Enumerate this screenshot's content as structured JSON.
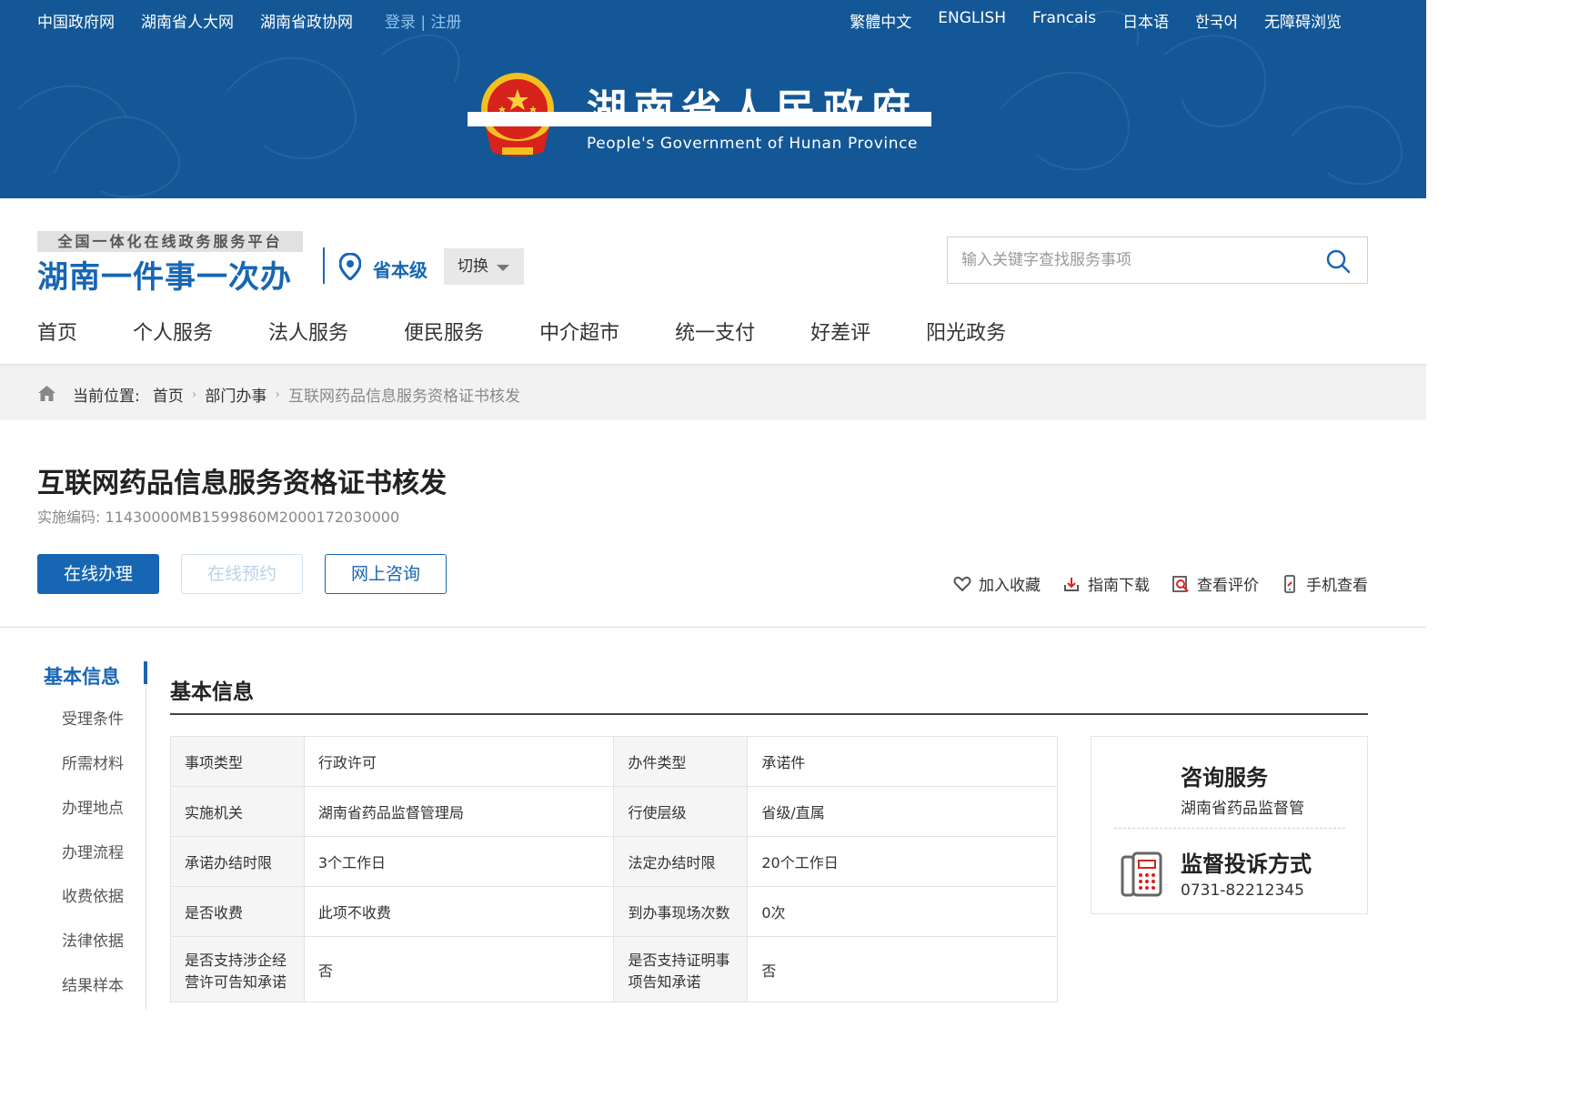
{
  "top_links": [
    "中国政府网",
    "湖南省人大网",
    "湖南省政协网"
  ],
  "auth": {
    "login": "登录",
    "sep": " | ",
    "register": "注册"
  },
  "languages": [
    "繁體中文",
    "ENGLISH",
    "Francais",
    "日本语",
    "한국어",
    "无障碍浏览"
  ],
  "banner": {
    "title": "湖南省人民政府",
    "subtitle": "People's Government of Hunan Province",
    "emblem_icon": "national-emblem-icon"
  },
  "header": {
    "platform_tag": "全国一体化在线政务服务平台",
    "brand": "湖南一件事一次办",
    "region": "省本级",
    "switch_label": "切换",
    "search_placeholder": "输入关键字查找服务事项"
  },
  "nav": [
    "首页",
    "个人服务",
    "法人服务",
    "便民服务",
    "中介超市",
    "统一支付",
    "好差评",
    "阳光政务"
  ],
  "breadcrumb": {
    "prefix": "当前位置:",
    "items": [
      "首页",
      "部门办事",
      "互联网药品信息服务资格证书核发"
    ]
  },
  "item": {
    "title": "互联网药品信息服务资格证书核发",
    "code_label": "实施编码:",
    "code": "11430000MB1599860M2000172030000"
  },
  "actions": {
    "online": "在线办理",
    "reserve": "在线预约",
    "consult": "网上咨询"
  },
  "tools": [
    "加入收藏",
    "指南下载",
    "查看评价",
    "手机查看"
  ],
  "sidenav": {
    "active": "基本信息",
    "items": [
      "受理条件",
      "所需材料",
      "办理地点",
      "办理流程",
      "收费依据",
      "法律依据",
      "结果样本"
    ]
  },
  "section_title": "基本信息",
  "info_table": [
    [
      "事项类型",
      "行政许可",
      "办件类型",
      "承诺件"
    ],
    [
      "实施机关",
      "湖南省药品监督管理局",
      "行使层级",
      "省级/直属"
    ],
    [
      "承诺办结时限",
      "3个工作日",
      "法定办结时限",
      "20个工作日"
    ],
    [
      "是否收费",
      "此项不收费",
      "到办事现场次数",
      "0次"
    ],
    [
      "是否支持涉企经营许可告知承诺",
      "否",
      "是否支持证明事项告知承诺",
      "否"
    ]
  ],
  "consult_box": {
    "title": "咨询服务",
    "org": "湖南省药品监督管",
    "complaint_title": "监督投诉方式",
    "phone": "0731-82212345"
  },
  "colors": {
    "banner": "#135796",
    "brand": "#1766b4"
  }
}
